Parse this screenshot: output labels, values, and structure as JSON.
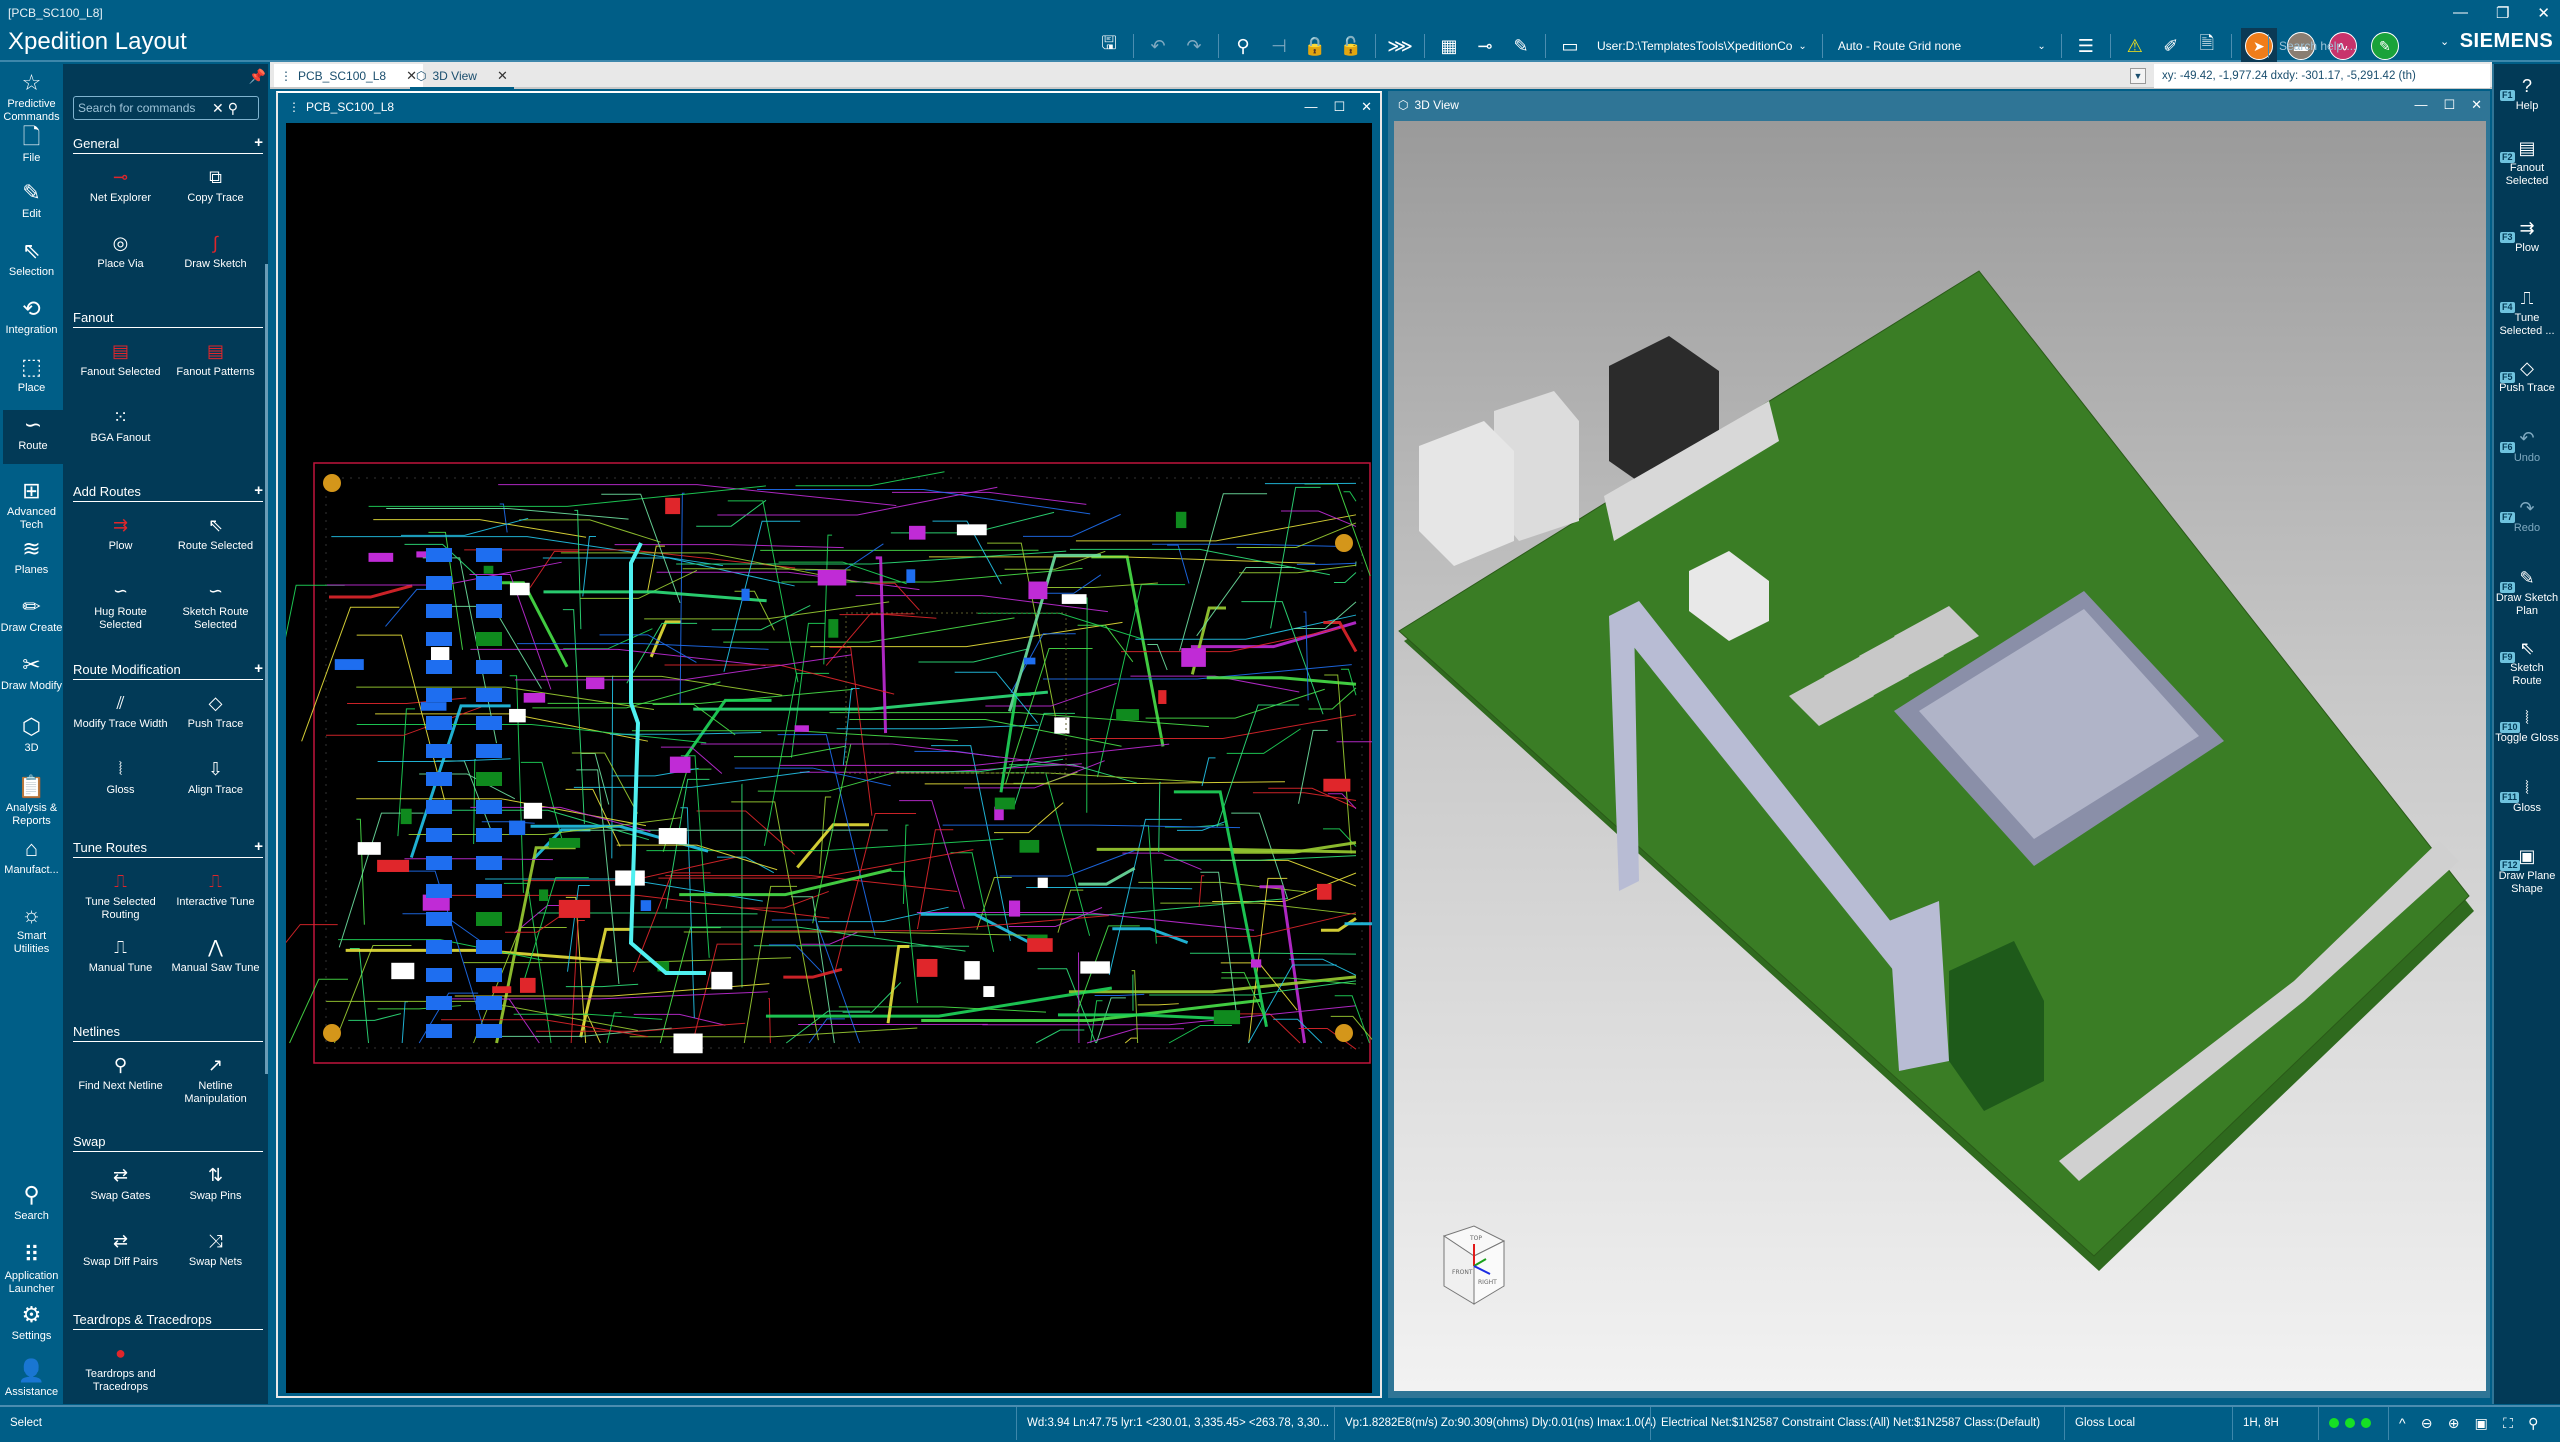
{
  "window": {
    "doc_title": "[PCB_SC100_L8]",
    "app_title": "Xpedition Layout",
    "minimize": "—",
    "restore": "❐",
    "close": "✕"
  },
  "toolbar": {
    "buttons": [
      {
        "name": "save-icon",
        "glyph": "🖫",
        "enabled": true
      },
      {
        "name": "undo-icon",
        "glyph": "↶",
        "enabled": false
      },
      {
        "name": "redo-icon",
        "glyph": "↷",
        "enabled": false
      },
      {
        "name": "fix-icon",
        "glyph": "⚲",
        "enabled": true
      },
      {
        "name": "unfix-icon",
        "glyph": "⊣",
        "enabled": false
      },
      {
        "name": "lock-icon",
        "glyph": "🔒",
        "enabled": true
      },
      {
        "name": "unlock-icon",
        "glyph": "🔓",
        "enabled": false
      },
      {
        "name": "sketch-router-icon",
        "glyph": "⋙",
        "enabled": true
      },
      {
        "name": "component-explorer-icon",
        "glyph": "▦",
        "enabled": true
      },
      {
        "name": "net-explorer-icon",
        "glyph": "⊸",
        "enabled": true
      },
      {
        "name": "editor-control-icon",
        "glyph": "✎",
        "enabled": true
      },
      {
        "name": "display-control-icon",
        "glyph": "▭",
        "enabled": true
      }
    ],
    "scheme_combo": "User:D:\\TemplatesTools\\XpeditionCo",
    "grid_combo": "Auto - Route Grid none",
    "right_buttons": [
      {
        "name": "properties-icon",
        "glyph": "☰"
      },
      {
        "name": "drc-warning-icon",
        "glyph": "⚠"
      },
      {
        "name": "edit-document-icon",
        "glyph": "✐"
      },
      {
        "name": "view-document-icon",
        "glyph": "🗎"
      }
    ],
    "modes": [
      {
        "name": "select-mode-button",
        "glyph": "➤",
        "color": "#f07d1a",
        "active": true
      },
      {
        "name": "place-mode-button",
        "glyph": "▬",
        "color": "#8a7e72",
        "active": false
      },
      {
        "name": "route-mode-button",
        "glyph": "∿",
        "color": "#c8336b",
        "active": false
      },
      {
        "name": "draw-mode-button",
        "glyph": "✎",
        "color": "#1aa23a",
        "active": false
      }
    ],
    "search_help_placeholder": "Search help ...",
    "brand": "SIEMENS"
  },
  "left_rail": [
    {
      "label": "Predictive Commands",
      "icon": "☆",
      "name": "predictive-commands"
    },
    {
      "label": "File",
      "icon": "🗋",
      "name": "file"
    },
    {
      "label": "Edit",
      "icon": "✎",
      "name": "edit"
    },
    {
      "label": "Selection",
      "icon": "⇖",
      "name": "selection"
    },
    {
      "label": "Integration",
      "icon": "⟲",
      "name": "integration"
    },
    {
      "label": "Place",
      "icon": "⬚",
      "name": "place"
    },
    {
      "label": "Route",
      "icon": "∽",
      "name": "route",
      "active": true
    },
    {
      "label": "Advanced Tech",
      "icon": "⊞",
      "name": "advanced-tech"
    },
    {
      "label": "Planes",
      "icon": "≋",
      "name": "planes"
    },
    {
      "label": "Draw Create",
      "icon": "✏",
      "name": "draw-create"
    },
    {
      "label": "Draw Modify",
      "icon": "✂",
      "name": "draw-modify"
    },
    {
      "label": "3D",
      "icon": "⬡",
      "name": "3d"
    },
    {
      "label": "Analysis & Reports",
      "icon": "📋",
      "name": "analysis-reports"
    },
    {
      "label": "Manufact...",
      "icon": "⌂",
      "name": "manufacturing"
    },
    {
      "label": "Smart Utilities",
      "icon": "☼",
      "name": "smart-utilities"
    },
    {
      "label": "Search",
      "icon": "⚲",
      "name": "search"
    },
    {
      "label": "Application Launcher",
      "icon": "⠿",
      "name": "application-launcher"
    },
    {
      "label": "Settings",
      "icon": "⚙",
      "name": "settings"
    },
    {
      "label": "Assistance",
      "icon": "👤",
      "name": "assistance"
    }
  ],
  "commands": {
    "search_placeholder": "Search for commands",
    "sections": [
      {
        "title": "General",
        "has_add": true,
        "items": [
          {
            "label": "Net Explorer",
            "icon": "⊸"
          },
          {
            "label": "Copy Trace",
            "icon": "⧉"
          },
          {
            "label": "Place Via",
            "icon": "◎"
          },
          {
            "label": "Draw Sketch",
            "icon": "∫"
          }
        ]
      },
      {
        "title": "Fanout",
        "has_add": false,
        "items": [
          {
            "label": "Fanout Selected",
            "icon": "▤"
          },
          {
            "label": "Fanout Patterns",
            "icon": "▤"
          },
          {
            "label": "BGA Fanout",
            "icon": "⁙"
          }
        ]
      },
      {
        "title": "Add Routes",
        "has_add": true,
        "items": [
          {
            "label": "Plow",
            "icon": "⇉"
          },
          {
            "label": "Route Selected",
            "icon": "⇖"
          },
          {
            "label": "Hug Route Selected",
            "icon": "∽"
          },
          {
            "label": "Sketch Route Selected",
            "icon": "∽"
          }
        ]
      },
      {
        "title": "Route Modification",
        "has_add": true,
        "items": [
          {
            "label": "Modify Trace Width",
            "icon": "⫽"
          },
          {
            "label": "Push Trace",
            "icon": "◇"
          },
          {
            "label": "Gloss",
            "icon": "⦚"
          },
          {
            "label": "Align Trace",
            "icon": "⇩"
          }
        ]
      },
      {
        "title": "Tune Routes",
        "has_add": true,
        "items": [
          {
            "label": "Tune Selected Routing",
            "icon": "⎍"
          },
          {
            "label": "Interactive Tune",
            "icon": "⎍"
          },
          {
            "label": "Manual Tune",
            "icon": "⎍"
          },
          {
            "label": "Manual Saw Tune",
            "icon": "⋀"
          }
        ]
      },
      {
        "title": "Netlines",
        "has_add": false,
        "items": [
          {
            "label": "Find Next Netline",
            "icon": "⚲"
          },
          {
            "label": "Netline Manipulation",
            "icon": "↗"
          }
        ]
      },
      {
        "title": "Swap",
        "has_add": false,
        "items": [
          {
            "label": "Swap Gates",
            "icon": "⇄"
          },
          {
            "label": "Swap Pins",
            "icon": "⇅"
          },
          {
            "label": "Swap Diff Pairs",
            "icon": "⇄"
          },
          {
            "label": "Swap Nets",
            "icon": "⤨"
          }
        ]
      },
      {
        "title": "Teardrops & Tracedrops",
        "has_add": false,
        "items": [
          {
            "label": "Teardrops and Tracedrops",
            "icon": "●"
          }
        ]
      }
    ]
  },
  "tabs": [
    {
      "label": "PCB_SC100_L8",
      "icon": "⋮",
      "selected": true
    },
    {
      "label": "3D View",
      "icon": "⬡",
      "selected": false
    }
  ],
  "coordinates": "xy: -49.42, -1,977.24  dxdy: -301.17, -5,291.42  (th)",
  "panes": {
    "pcb": {
      "title": "PCB_SC100_L8"
    },
    "view3d": {
      "title": "3D View",
      "cube_labels": {
        "top": "TOP",
        "front": "FRONT",
        "right": "RIGHT"
      }
    }
  },
  "right_rail": [
    {
      "key": "F1",
      "label": "Help",
      "icon": "?",
      "enabled": true
    },
    {
      "key": "F2",
      "label": "Fanout Selected",
      "icon": "▤",
      "enabled": true
    },
    {
      "key": "F3",
      "label": "Plow",
      "icon": "⇉",
      "enabled": true
    },
    {
      "key": "F4",
      "label": "Tune Selected ...",
      "icon": "⎍",
      "enabled": true
    },
    {
      "key": "F5",
      "label": "Push Trace",
      "icon": "◇",
      "enabled": true
    },
    {
      "key": "F6",
      "label": "Undo",
      "icon": "↶",
      "enabled": false
    },
    {
      "key": "F7",
      "label": "Redo",
      "icon": "↷",
      "enabled": false
    },
    {
      "key": "F8",
      "label": "Draw Sketch Plan",
      "icon": "✎",
      "enabled": true
    },
    {
      "key": "F9",
      "label": "Sketch Route",
      "icon": "⇖",
      "enabled": true
    },
    {
      "key": "F10",
      "label": "Toggle Gloss",
      "icon": "⦚",
      "enabled": true
    },
    {
      "key": "F11",
      "label": "Gloss",
      "icon": "⦚",
      "enabled": true
    },
    {
      "key": "F12",
      "label": "Draw Plane Shape",
      "icon": "▣",
      "enabled": true
    }
  ],
  "status": {
    "mode": "Select",
    "trace_info": "Wd:3.94 Ln:47.75 lyr:1  <230.01, 3,335.45> <263.78, 3,30...",
    "electrical": "Vp:1.8282E8(m/s) Zo:90.309(ohms) Dly:0.01(ns) Imax:1.0(A)",
    "net": "Electrical Net:$1N2587 Constraint Class:(All) Net:$1N2587 Class:(Default)",
    "gloss": "Gloss Local",
    "layers": "1H, 8H",
    "indicator_color": "#16e024"
  }
}
